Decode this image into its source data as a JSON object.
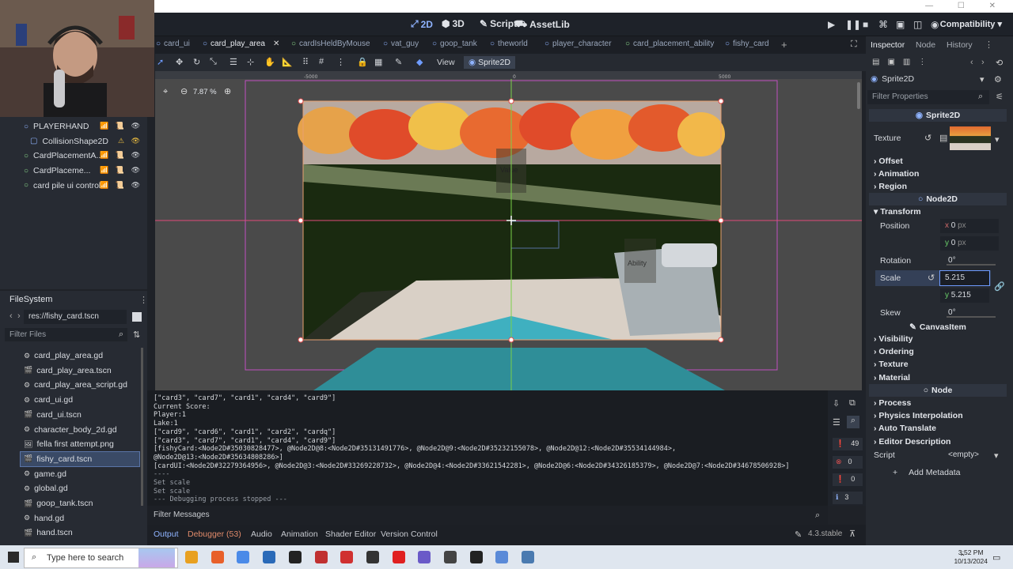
{
  "topbar": {
    "controls": "— ☐ ✕"
  },
  "modes": [
    {
      "label": "2D",
      "icon": "2d-icon",
      "active": true
    },
    {
      "label": "3D",
      "icon": "3d-icon",
      "active": false
    },
    {
      "label": "Script",
      "icon": "script-icon",
      "active": false
    },
    {
      "label": "AssetLib",
      "icon": "assetlib-icon",
      "active": false
    }
  ],
  "renderer": "Compatibility",
  "scene_tree": [
    {
      "label": "PLAYERHAND",
      "indent": 0,
      "color": "#8fb3ff",
      "warn": false
    },
    {
      "label": "CollisionShape2D",
      "indent": 1,
      "color": "#8fb3ff",
      "warn": true
    },
    {
      "label": "CardPlacementA...",
      "indent": 0,
      "color": "#8bd98a",
      "warn": false
    },
    {
      "label": "CardPlaceme...",
      "indent": 0,
      "color": "#8bd98a",
      "warn": false
    },
    {
      "label": "card pile ui control",
      "indent": 0,
      "color": "#8bd98a",
      "warn": false
    }
  ],
  "filesystem": {
    "title": "FileSystem",
    "path": "res://fishy_card.tscn",
    "filter_placeholder": "Filter Files",
    "files": [
      {
        "name": "card_play_area.gd",
        "type": "gear",
        "selected": false
      },
      {
        "name": "card_play_area.tscn",
        "type": "scene",
        "selected": false
      },
      {
        "name": "card_play_area_script.gd",
        "type": "gear",
        "selected": false
      },
      {
        "name": "card_ui.gd",
        "type": "gear",
        "selected": false
      },
      {
        "name": "card_ui.tscn",
        "type": "scene",
        "selected": false
      },
      {
        "name": "character_body_2d.gd",
        "type": "gear",
        "selected": false
      },
      {
        "name": "fella first attempt.png",
        "type": "image",
        "selected": false
      },
      {
        "name": "fishy_card.tscn",
        "type": "scene",
        "selected": true
      },
      {
        "name": "game.gd",
        "type": "gear",
        "selected": false
      },
      {
        "name": "global.gd",
        "type": "gear",
        "selected": false
      },
      {
        "name": "goop_tank.tscn",
        "type": "scene",
        "selected": false
      },
      {
        "name": "hand.gd",
        "type": "gear",
        "selected": false
      },
      {
        "name": "hand.tscn",
        "type": "scene",
        "selected": false
      }
    ]
  },
  "scene_tabs": [
    {
      "label": "card_ui",
      "active": false
    },
    {
      "label": "card_play_area",
      "active": true
    },
    {
      "label": "cardIsHeldByMouse",
      "active": false
    },
    {
      "label": "vat_guy",
      "active": false
    },
    {
      "label": "goop_tank",
      "active": false
    },
    {
      "label": "theworld",
      "active": false
    },
    {
      "label": "player_character",
      "active": false
    },
    {
      "label": "card_placement_ability",
      "active": false
    },
    {
      "label": "fishy_card",
      "active": false
    }
  ],
  "toolbar": {
    "view": "View",
    "breadcrumb": "Sprite2D"
  },
  "viewport": {
    "zoom": "7.87 %",
    "ruler_left": "-5000",
    "ruler_center": "0",
    "ruler_right": "5000",
    "label_value": "Value",
    "label_ability": "Ability"
  },
  "output_lines": [
    "[\"card3\", \"card7\", \"card1\", \"card4\", \"card9\"]",
    "Current Score:",
    "Player:1",
    "Lake:1",
    "[\"card9\", \"card6\", \"card1\", \"card2\", \"cardq\"]",
    "[\"card3\", \"card7\", \"card1\", \"card4\", \"card9\"]",
    "[fishyCard:<Node2D#35030828477>, @Node2D@8:<Node2D#35131491776>, @Node2D@9:<Node2D#35232155078>, @Node2D@12:<Node2D#35534144984>,",
    "@Node2D@13:<Node2D#35634808286>]",
    "[cardUI:<Node2D#32279364956>, @Node2D@3:<Node2D#33269228732>, @Node2D@4:<Node2D#33621542281>, @Node2D@6:<Node2D#34326185379>, @Node2D@7:<Node2D#34678506928>]",
    "----",
    "Set scale",
    "Set scale",
    "--- Debugging process stopped ---"
  ],
  "output_counts": [
    "49",
    "0",
    "0",
    "3"
  ],
  "filter_messages": "Filter Messages",
  "bottom_tabs": [
    "Output",
    "Debugger (53)",
    "Audio",
    "Animation",
    "Shader Editor",
    "Version Control"
  ],
  "version": "4.3.stable",
  "inspector": {
    "tabs": [
      "Inspector",
      "Node",
      "History"
    ],
    "node_type": "Sprite2D",
    "filter_placeholder": "Filter Properties",
    "class_header": "Sprite2D",
    "texture_label": "Texture",
    "sections_sprite": [
      "Offset",
      "Animation",
      "Region"
    ],
    "node2d_header": "Node2D",
    "transform_label": "Transform",
    "position_label": "Position",
    "position_x": "0",
    "position_y": "0",
    "position_unit": "px",
    "rotation_label": "Rotation",
    "rotation_value": "0",
    "scale_label": "Scale",
    "scale_x": "5.215",
    "scale_y": "5.215",
    "skew_label": "Skew",
    "skew_value": "0",
    "canvasitem_header": "CanvasItem",
    "sections_canvas": [
      "Visibility",
      "Ordering",
      "Texture",
      "Material"
    ],
    "node_header": "Node",
    "sections_node": [
      "Process",
      "Physics Interpolation",
      "Auto Translate",
      "Editor Description"
    ],
    "script_label": "Script",
    "script_value": "<empty>",
    "add_metadata": "Add Metadata"
  },
  "taskbar": {
    "search_placeholder": "Type here to search",
    "time": "3:52 PM",
    "date": "10/13/2024"
  }
}
